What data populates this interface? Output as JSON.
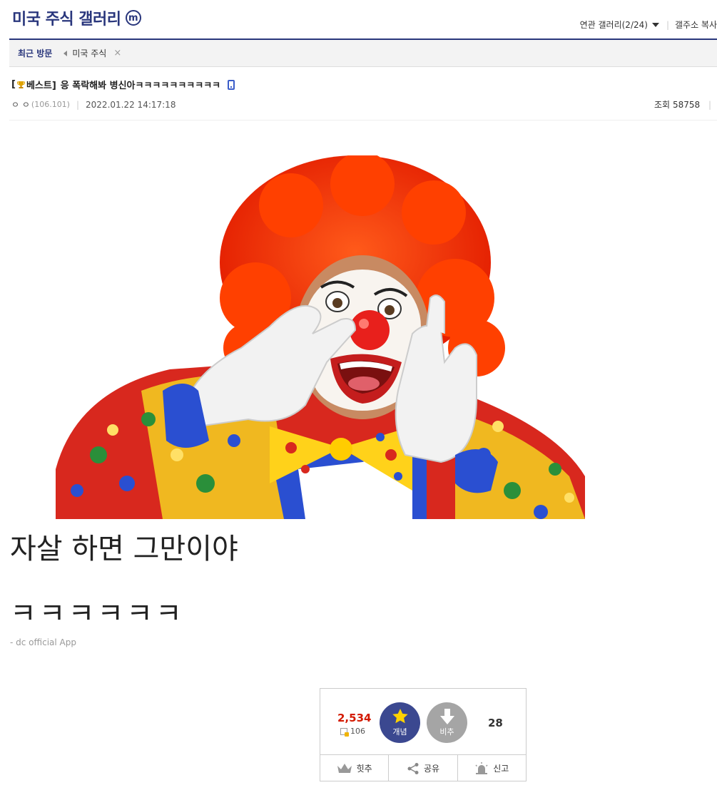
{
  "header": {
    "gallery_title": "미국 주식 갤러리",
    "m_badge": "m",
    "related_gallery": "연관 갤러리(2/24)",
    "copy_address": "갤주소 복사"
  },
  "visit_bar": {
    "label": "최근 방문",
    "items": [
      "미국 주식"
    ],
    "close": "×"
  },
  "post": {
    "title_prefix_open": "[",
    "best_label": "베스트]",
    "title_text": "응 폭락해봐 병신아ㅋㅋㅋㅋㅋㅋㅋㅋㅋㅋ",
    "author": "ㅇ ㅇ",
    "ip": "(106.101)",
    "datetime": "2022.01.22 14:17:18",
    "views_label": "조회",
    "views_value": "58758",
    "body_line1": "자살 하면 그만이야",
    "body_line2": "ㅋㅋㅋㅋㅋㅋ",
    "app_sign": "- dc official App"
  },
  "recommend": {
    "up_count": "2,534",
    "fixed_count": "106",
    "up_label": "개념",
    "down_label": "비추",
    "down_count": "28",
    "hit_label": "힛추",
    "share_label": "공유",
    "report_label": "신고"
  },
  "colors": {
    "brand": "#29367c",
    "up_button": "#3b4890",
    "down_button": "#a5a5a5",
    "up_count": "#d31900"
  }
}
